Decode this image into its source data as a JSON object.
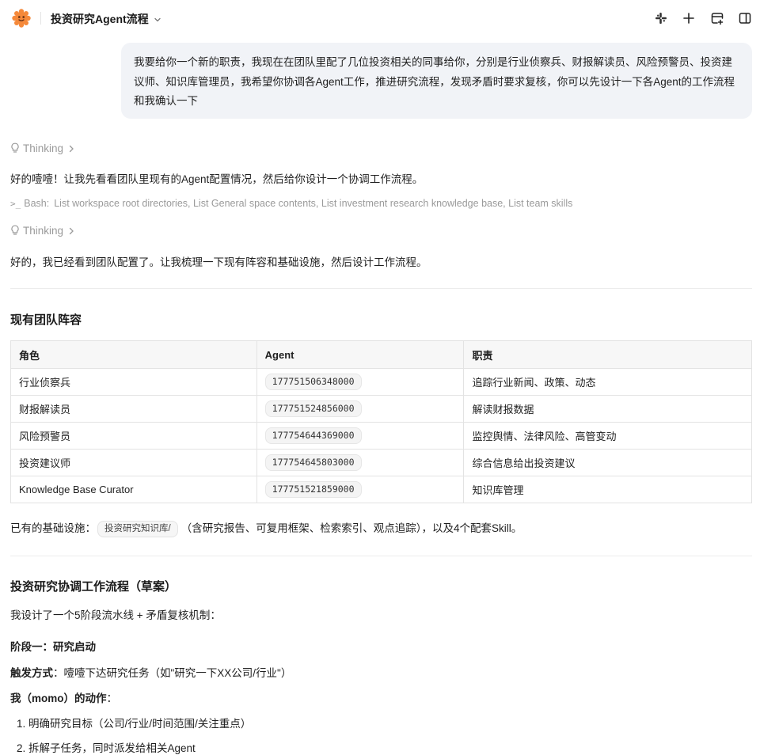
{
  "topbar": {
    "title": "投资研究Agent流程",
    "icons": [
      "app-logo-icon",
      "slack-icon",
      "plus-icon",
      "new-window-icon",
      "sidebar-toggle-icon"
    ]
  },
  "user_message": "我要给你一个新的职责，我现在在团队里配了几位投资相关的同事给你，分别是行业侦察兵、财报解读员、风险预警员、投资建议师、知识库管理员，我希望你协调各Agent工作，推进研究流程，发现矛盾时要求复核，你可以先设计一下各Agent的工作流程和我确认一下",
  "thinking_label": "Thinking",
  "reply_1": "好的噎噎！让我先看看团队里现有的Agent配置情况，然后给你设计一个协调工作流程。",
  "tool_call": {
    "name": "Bash:",
    "detail": "List workspace root directories, List General space contents, List investment research knowledge base, List team skills"
  },
  "reply_2": "好的，我已经看到团队配置了。让我梳理一下现有阵容和基础设施，然后设计工作流程。",
  "team_section": {
    "heading": "现有团队阵容",
    "headers": [
      "角色",
      "Agent",
      "职责"
    ],
    "rows": [
      {
        "role": "行业侦察兵",
        "agent": "177751506348000",
        "duty": "追踪行业新闻、政策、动态"
      },
      {
        "role": "财报解读员",
        "agent": "177751524856000",
        "duty": "解读财报数据"
      },
      {
        "role": "风险预警员",
        "agent": "177754644369000",
        "duty": "监控舆情、法律风险、高管变动"
      },
      {
        "role": "投资建议师",
        "agent": "177754645803000",
        "duty": "综合信息给出投资建议"
      },
      {
        "role": "Knowledge Base Curator",
        "agent": "177751521859000",
        "duty": "知识库管理"
      }
    ]
  },
  "infra": {
    "prefix": "已有的基础设施：",
    "tag": "投资研究知识库/",
    "suffix": "（含研究报告、可复用框架、检索索引、观点追踪），以及4个配套Skill。"
  },
  "workflow": {
    "heading": "投资研究协调工作流程（草案）",
    "intro": "我设计了一个5阶段流水线 + 矛盾复核机制：",
    "stage1_title": "阶段一：研究启动",
    "trigger_label": "触发方式",
    "trigger_text": "：噎噎下达研究任务（如\"研究一下XX公司/行业\"）",
    "action_label": "我（momo）的动作",
    "action_suffix": "：",
    "steps": [
      "1. 明确研究目标（公司/行业/时间范围/关注重点）",
      "2. 拆解子任务，同时派发给相关Agent"
    ]
  }
}
